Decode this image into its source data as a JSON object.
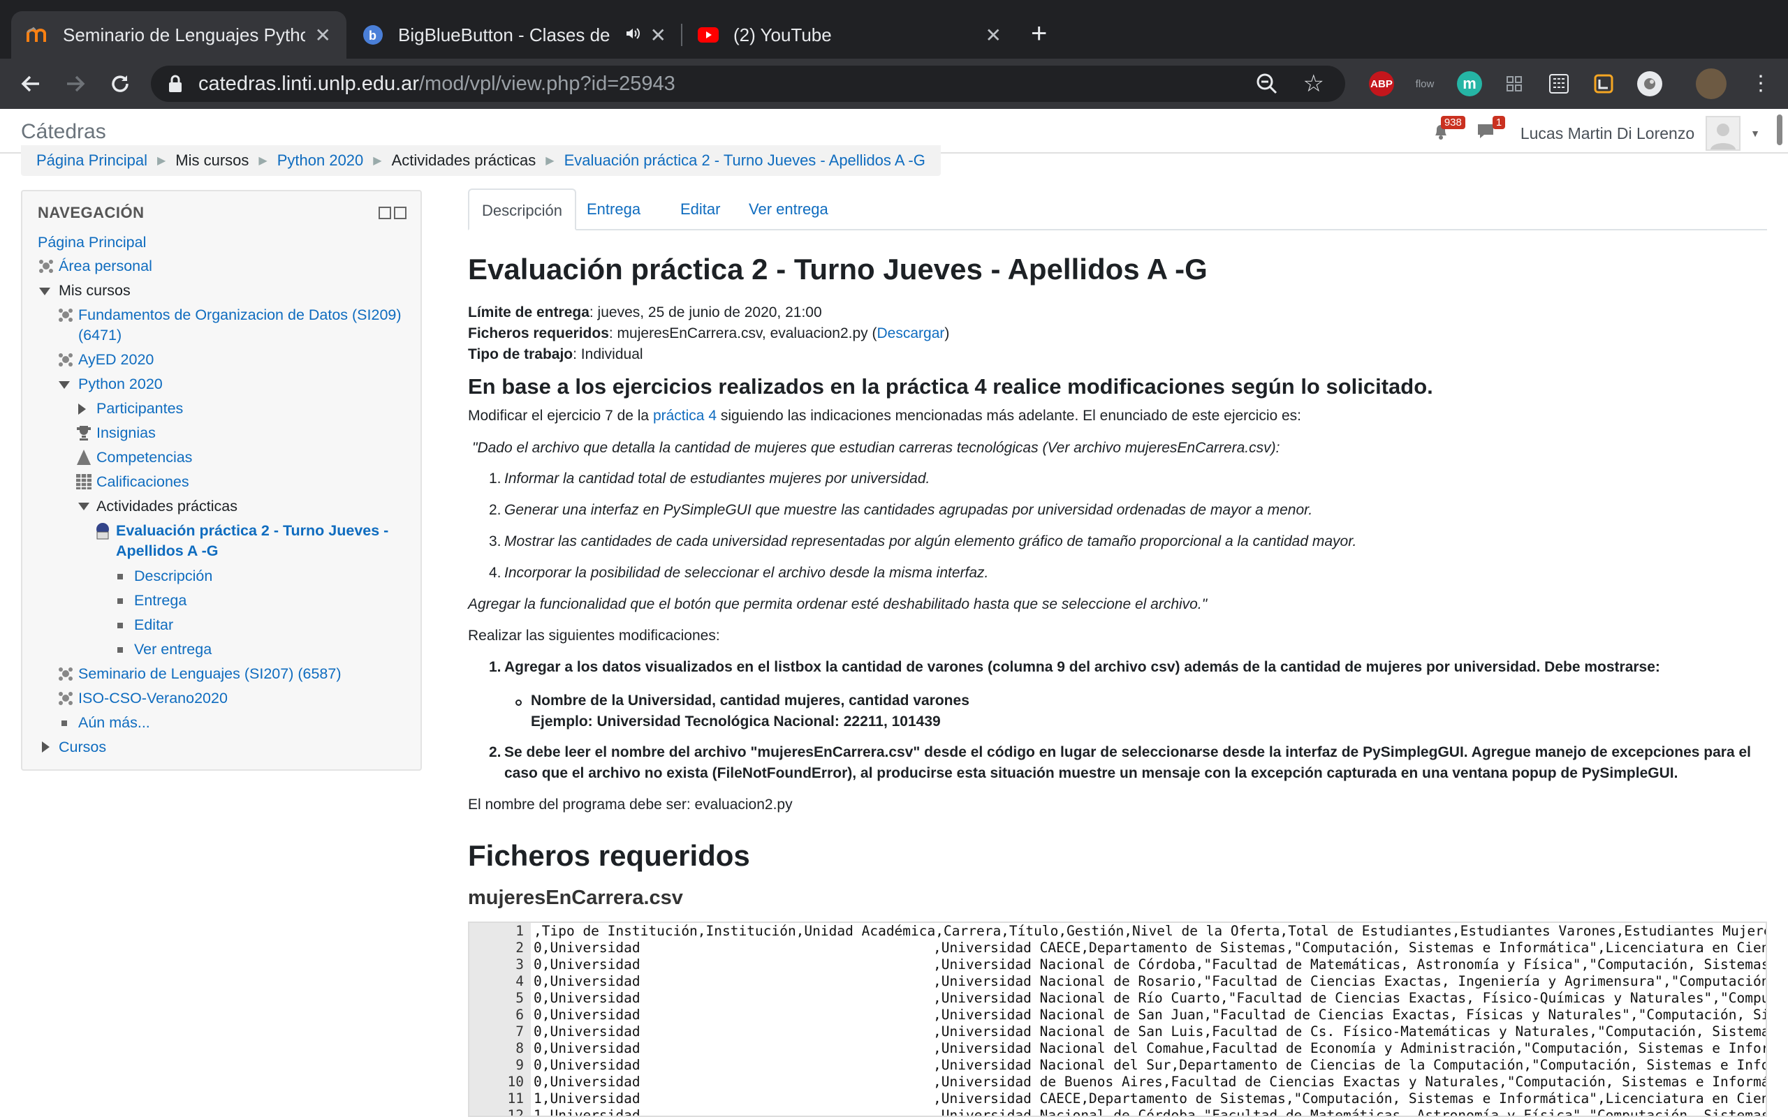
{
  "browser": {
    "tabs": [
      {
        "title": "Seminario de Lenguajes Python",
        "favicon": "moodle-icon",
        "active": true
      },
      {
        "title": "BigBlueButton - Clases de",
        "favicon": "bigbluebutton-icon",
        "audio": true
      },
      {
        "title": "(2) YouTube",
        "favicon": "youtube-icon"
      }
    ],
    "url_host": "catedras.linti.unlp.edu.ar",
    "url_path": "/mod/vpl/view.php?id=25943",
    "extensions": [
      "ABP",
      "flow",
      "m"
    ]
  },
  "site": {
    "name": "Cátedras",
    "user_name": "Lucas Martin Di Lorenzo",
    "notifications_count": "938",
    "messages_count": "1"
  },
  "breadcrumb": [
    "Página Principal",
    "Mis cursos",
    "Python 2020",
    "Actividades prácticas",
    "Evaluación práctica 2 - Turno Jueves - Apellidos A -G"
  ],
  "navigation": {
    "title": "NAVEGACIÓN",
    "items": [
      "Página Principal",
      "Área personal",
      "Mis cursos",
      "Fundamentos de Organizacion de Datos (SI209)",
      "(6471)",
      "AyED 2020",
      "Python 2020",
      "Participantes",
      "Insignias",
      "Competencias",
      "Calificaciones",
      "Actividades prácticas",
      "Evaluación práctica 2 - Turno Jueves -",
      "Apellidos A -G",
      "Descripción",
      "Entrega",
      "Editar",
      "Ver entrega",
      "Seminario de Lenguajes (SI207) (6587)",
      "ISO-CSO-Verano2020",
      "Aún más...",
      "Cursos"
    ]
  },
  "main": {
    "tabs": [
      "Descripción",
      "Entrega",
      "Editar",
      "Ver entrega"
    ],
    "title": "Evaluación práctica 2 - Turno Jueves - Apellidos A -G",
    "due_label": "Límite de entrega",
    "due_value": ": jueves, 25 de junio de 2020, 21:00",
    "files_label": "Ficheros requeridos",
    "files_value": ": mujeresEnCarrera.csv, evaluacion2.py (",
    "files_link": "Descargar",
    "files_close": ")",
    "type_label": "Tipo de trabajo",
    "type_value": ": Individual",
    "subtitle": "En base a los ejercicios realizados en la práctica 4 realice modificaciones según lo solicitado.",
    "intro_pre": "Modificar el ejercicio 7 de la ",
    "intro_link": "práctica 4",
    "intro_post": " siguiendo las indicaciones mencionadas más adelante. El enunciado de este ejercicio es:",
    "quote_intro": "\"Dado el archivo que detalla la cantidad de mujeres que estudian carreras tecnológicas (Ver archivo mujeresEnCarrera.csv):",
    "quote_items": [
      "Informar la cantidad total de estudiantes mujeres por universidad.",
      "Generar una interfaz en PySimpleGUI que muestre las cantidades agrupadas por universidad ordenadas de mayor a menor.",
      "Mostrar las cantidades de cada universidad representadas por algún elemento gráfico de tamaño proporcional a la cantidad mayor.",
      "Incorporar la posibilidad de seleccionar el archivo desde la misma interfaz."
    ],
    "quote_end": "Agregar la funcionalidad que el botón que permita ordenar esté deshabilitado hasta que se seleccione el archivo.\"",
    "mods_intro": "Realizar las siguientes modificaciones:",
    "mod1": "Agregar a los datos visualizados en el listbox la cantidad de varones (columna 9 del archivo csv) además de la cantidad de mujeres por universidad. Debe mostrarse:",
    "mod1_sub1": "Nombre de la Universidad, cantidad mujeres, cantidad varones",
    "mod1_sub2": "Ejemplo: Universidad Tecnológica Nacional: 22211, 101439",
    "mod2_line1": "Se debe leer el nombre del archivo \"mujeresEnCarrera.csv\" desde el código en lugar de seleccionarse desde la interfaz de PySimplegGUI. Agregue manejo de excepciones para el",
    "mod2_line2": "caso que el archivo no exista (FileNotFoundError), al producirse esta situación muestre un mensaje con la excepción capturada en una ventana popup de PySimpleGUI.",
    "program_name": "El nombre del programa debe ser: evaluacion2.py",
    "files_heading": "Ficheros requeridos",
    "file_name": "mujeresEnCarrera.csv"
  },
  "code_lines": [
    {
      "n": "1",
      "a": ",Tipo de Institución,Institución,Unidad Académica,Carrera,Título,Gestión,Nivel de la Oferta,Total de Estudiantes,Estudiantes Varones,Estudiantes Mujeres,Total de Nu",
      "b": ""
    },
    {
      "n": "2",
      "a": "0,Universidad",
      "b": ",Universidad CAECE,Departamento de Sistemas,\"Computación, Sistemas e Informática\",Licenciatura en Ciencias de la"
    },
    {
      "n": "3",
      "a": "0,Universidad",
      "b": ",Universidad Nacional de Córdoba,\"Facultad de Matemáticas, Astronomía y Física\",\"Computación, Sistemas e Inform"
    },
    {
      "n": "4",
      "a": "0,Universidad",
      "b": ",Universidad Nacional de Rosario,\"Facultad de Ciencias Exactas, Ingeniería y Agrimensura\",\"Computación, Sistemas"
    },
    {
      "n": "5",
      "a": "0,Universidad",
      "b": ",Universidad Nacional de Río Cuarto,\"Facultad de Ciencias Exactas, Físico-Químicas y Naturales\",\"Computación, Si"
    },
    {
      "n": "6",
      "a": "0,Universidad",
      "b": ",Universidad Nacional de San Juan,\"Facultad de Ciencias Exactas, Físicas y Naturales\",\"Computación, Sistemas e I"
    },
    {
      "n": "7",
      "a": "0,Universidad",
      "b": ",Universidad Nacional de San Luis,Facultad de Cs. Físico-Matemáticas y Naturales,\"Computación, Sistemas e Inform"
    },
    {
      "n": "8",
      "a": "0,Universidad",
      "b": ",Universidad Nacional del Comahue,Facultad de Economía y Administración,\"Computación, Sistemas e Informática\",Li"
    },
    {
      "n": "9",
      "a": "0,Universidad",
      "b": ",Universidad Nacional del Sur,Departamento de Ciencias de la Computación,\"Computación, Sistemas e Informática\",L"
    },
    {
      "n": "10",
      "a": "0,Universidad",
      "b": ",Universidad de Buenos Aires,Facultad de Ciencias Exactas y Naturales,\"Computación, Sistemas e Informática\",Lice"
    },
    {
      "n": "11",
      "a": "1,Universidad",
      "b": ",Universidad CAECE,Departamento de Sistemas,\"Computación, Sistemas e Informática\",Licenciatura en Ciencias de la"
    },
    {
      "n": "12",
      "a": "1,Universidad",
      "b": ",Universidad Nacional de Córdoba,\"Facultad de Matemáticas, Astronomía y Física\",\"Computación, Sistemas e Inform"
    }
  ]
}
